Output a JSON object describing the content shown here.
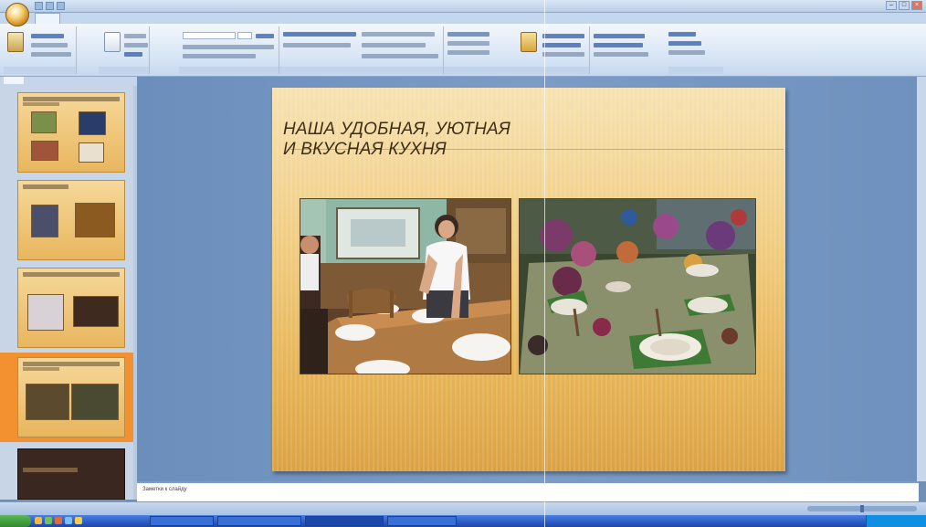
{
  "window": {
    "title": ""
  },
  "ribbon": {
    "tabs": [
      "",
      "",
      "",
      "",
      "",
      "",
      "",
      ""
    ],
    "active_tab_index": 0
  },
  "left_panel": {
    "tabs": [
      "",
      ""
    ],
    "selected_slide": 4
  },
  "slide": {
    "title_line1": "НАША УДОБНАЯ, УЮТНАЯ",
    "title_line2": "И ВКУСНАЯ КУХНЯ"
  },
  "notes": {
    "placeholder": "Заметки к слайду"
  },
  "status": {
    "text": ""
  },
  "taskbar": {
    "start_label": "",
    "items": [
      "",
      "",
      "",
      ""
    ]
  },
  "colors": {
    "slide_gradient_top": "#f6e2b2",
    "slide_gradient_bottom": "#dba244",
    "selected_thumb": "#f3902f",
    "workspace": "#7c9cc6"
  },
  "icons": [
    "office-button-icon",
    "save-icon",
    "undo-icon",
    "redo-icon",
    "minimize-icon",
    "maximize-icon",
    "close-icon"
  ]
}
